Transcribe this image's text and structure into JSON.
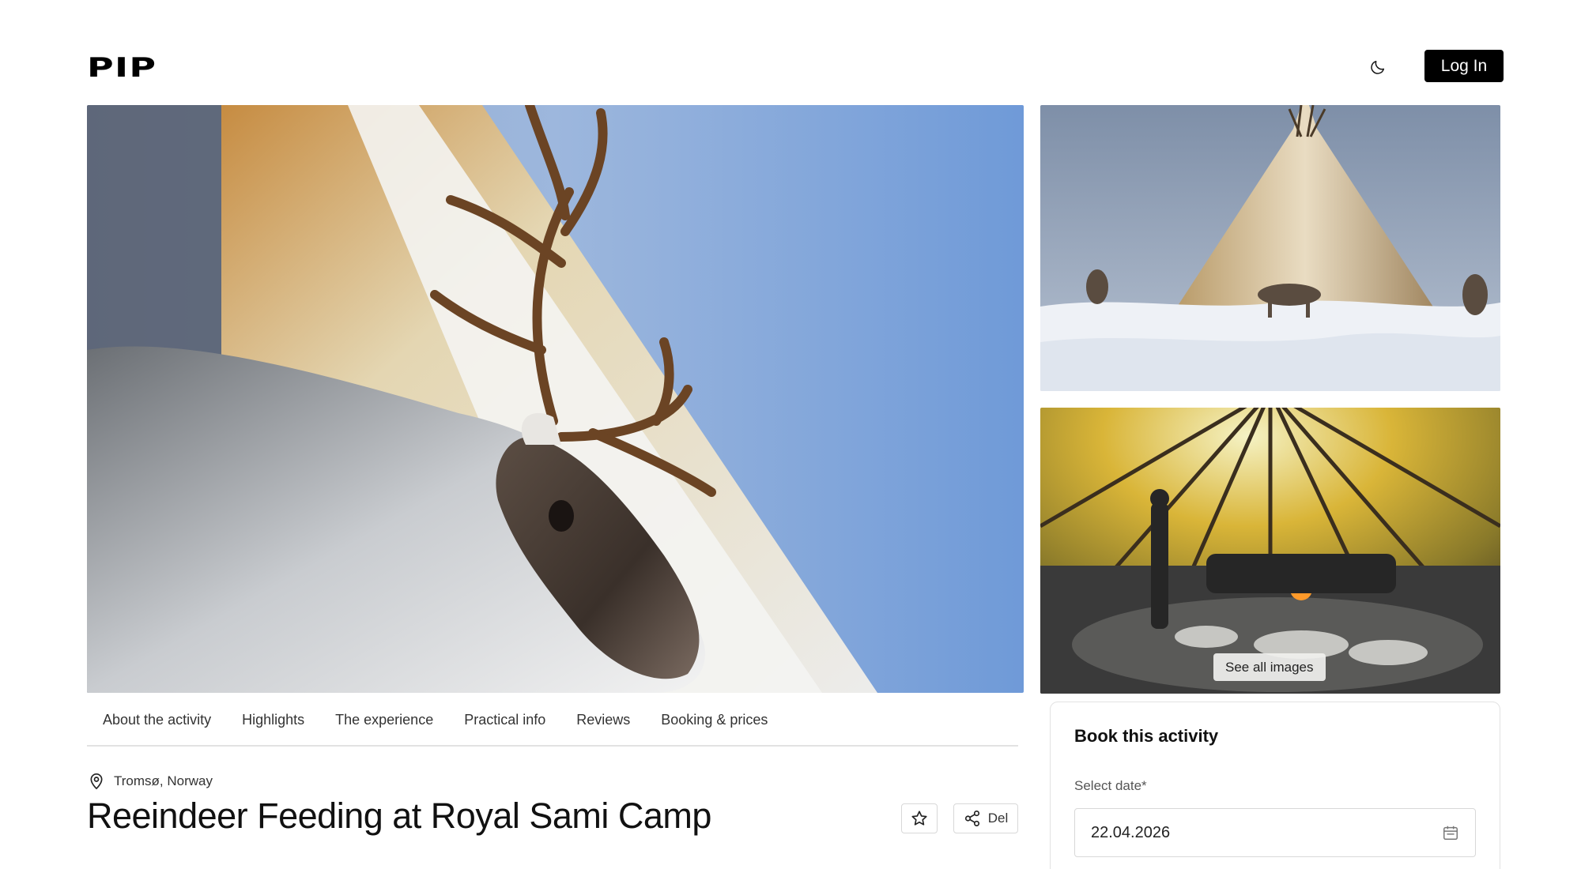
{
  "header": {
    "logo": "PIP",
    "login_label": "Log In",
    "theme_icon": "moon-icon"
  },
  "gallery": {
    "see_all_label": "See all images"
  },
  "tabs": [
    {
      "label": "About the activity"
    },
    {
      "label": "Highlights"
    },
    {
      "label": "The experience"
    },
    {
      "label": "Practical info"
    },
    {
      "label": "Reviews"
    },
    {
      "label": "Booking & prices"
    }
  ],
  "activity": {
    "location": "Tromsø, Norway",
    "title": "Reeindeer Feeding at Royal Sami Camp",
    "share_label": "Del"
  },
  "booking": {
    "title": "Book this activity",
    "date_label": "Select date*",
    "date_value": "22.04.2026"
  },
  "colors": {
    "primary": "#000000",
    "border": "#e2e2e2",
    "text": "#111111"
  }
}
